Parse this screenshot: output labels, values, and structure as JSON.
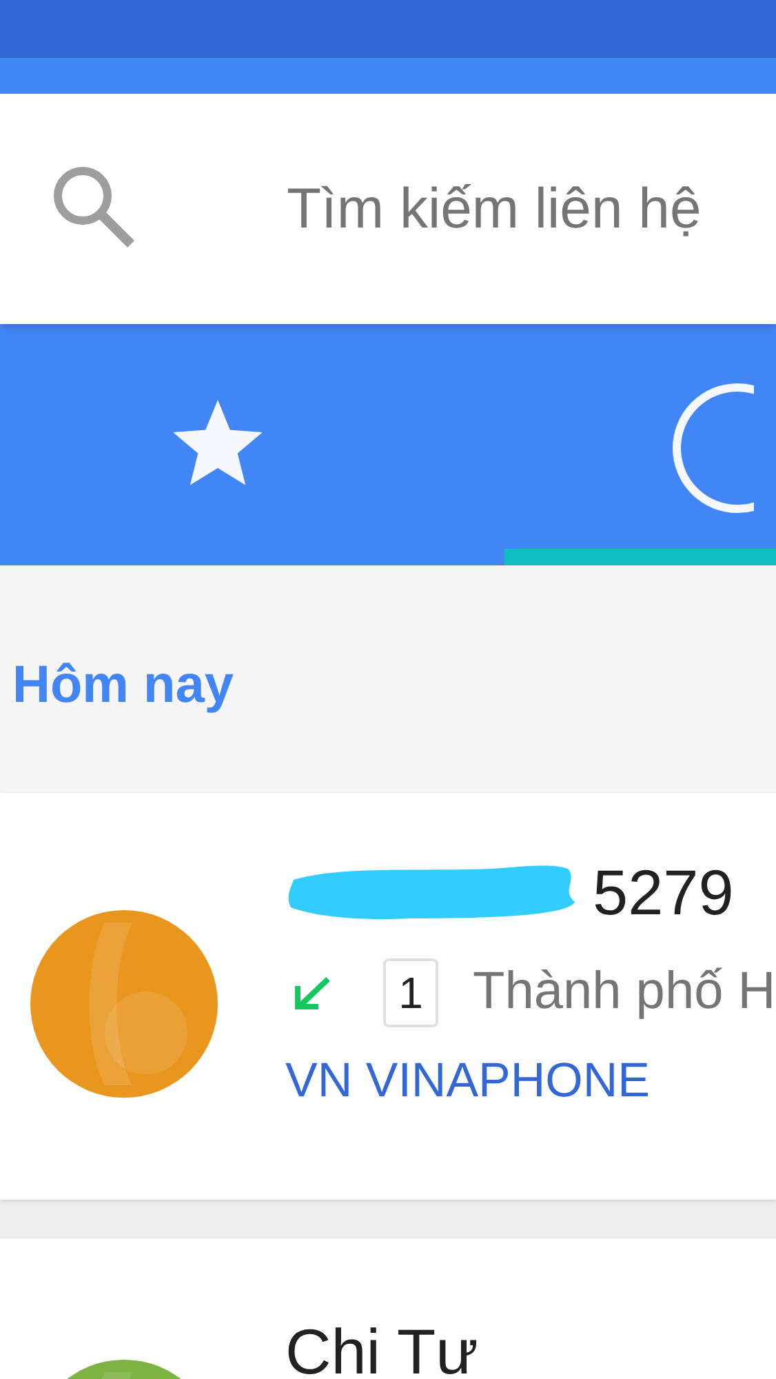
{
  "search": {
    "placeholder": "Tìm kiếm liên hệ"
  },
  "tabs": [
    {
      "kind": "favorites",
      "selected": false
    },
    {
      "kind": "recent",
      "selected": true
    }
  ],
  "section": "Hôm nay",
  "calls": [
    {
      "kind": "incoming",
      "redacted": true,
      "title": "5279",
      "sim": "1",
      "location": "Thành phố H",
      "carrier": "VN VINAPHONE",
      "color": "#e8961e"
    },
    {
      "title": "Chi Tư",
      "color": "#7cb342"
    }
  ]
}
